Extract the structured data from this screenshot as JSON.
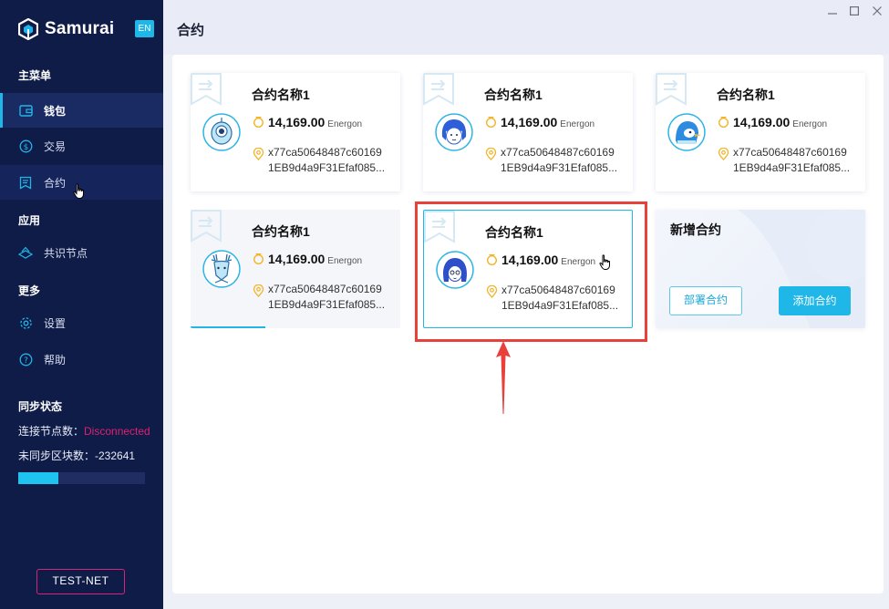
{
  "brand": {
    "name": "Samurai",
    "lang": "EN"
  },
  "sidebar": {
    "main_menu_title": "主菜单",
    "main_items": [
      {
        "label": "钱包",
        "icon": "wallet-icon"
      },
      {
        "label": "交易",
        "icon": "dollar-circle-icon"
      },
      {
        "label": "合约",
        "icon": "contract-icon"
      }
    ],
    "apps_title": "应用",
    "app_items": [
      {
        "label": "共识节点",
        "icon": "node-icon"
      }
    ],
    "more_title": "更多",
    "more_items": [
      {
        "label": "设置",
        "icon": "gear-icon"
      },
      {
        "label": "帮助",
        "icon": "help-icon"
      }
    ],
    "sync": {
      "title": "同步状态",
      "connected_label": "连接节点数：",
      "connected_value": "Disconnected",
      "unsynced_label": "未同步区块数：",
      "unsynced_value": "-232641",
      "progress": 0.32
    },
    "network": "TEST-NET"
  },
  "header": {
    "title": "合约"
  },
  "cards": [
    {
      "name": "合约名称1",
      "balance": "14,169.00",
      "unit": "Energon",
      "addr1": "x77ca50648487c60169",
      "addr2": "1EB9d4a9F31Efaf085...",
      "avatar": "alien-avatar"
    },
    {
      "name": "合约名称1",
      "balance": "14,169.00",
      "unit": "Energon",
      "addr1": "x77ca50648487c60169",
      "addr2": "1EB9d4a9F31Efaf085...",
      "avatar": "girl-avatar"
    },
    {
      "name": "合约名称1",
      "balance": "14,169.00",
      "unit": "Energon",
      "addr1": "x77ca50648487c60169",
      "addr2": "1EB9d4a9F31Efaf085...",
      "avatar": "penguin-avatar"
    },
    {
      "name": "合约名称1",
      "balance": "14,169.00",
      "unit": "Energon",
      "addr1": "x77ca50648487c60169",
      "addr2": "1EB9d4a9F31Efaf085...",
      "avatar": "deer-avatar"
    },
    {
      "name": "合约名称1",
      "balance": "14,169.00",
      "unit": "Energon",
      "addr1": "x77ca50648487c60169",
      "addr2": "1EB9d4a9F31Efaf085...",
      "avatar": "woman-avatar"
    }
  ],
  "new_contract": {
    "title": "新增合约",
    "deploy_label": "部署合约",
    "add_label": "添加合约"
  },
  "colors": {
    "sidebar_bg": "#0f1c48",
    "accent": "#1fb6e8",
    "danger": "#e0206f",
    "highlight": "#e8413c"
  }
}
